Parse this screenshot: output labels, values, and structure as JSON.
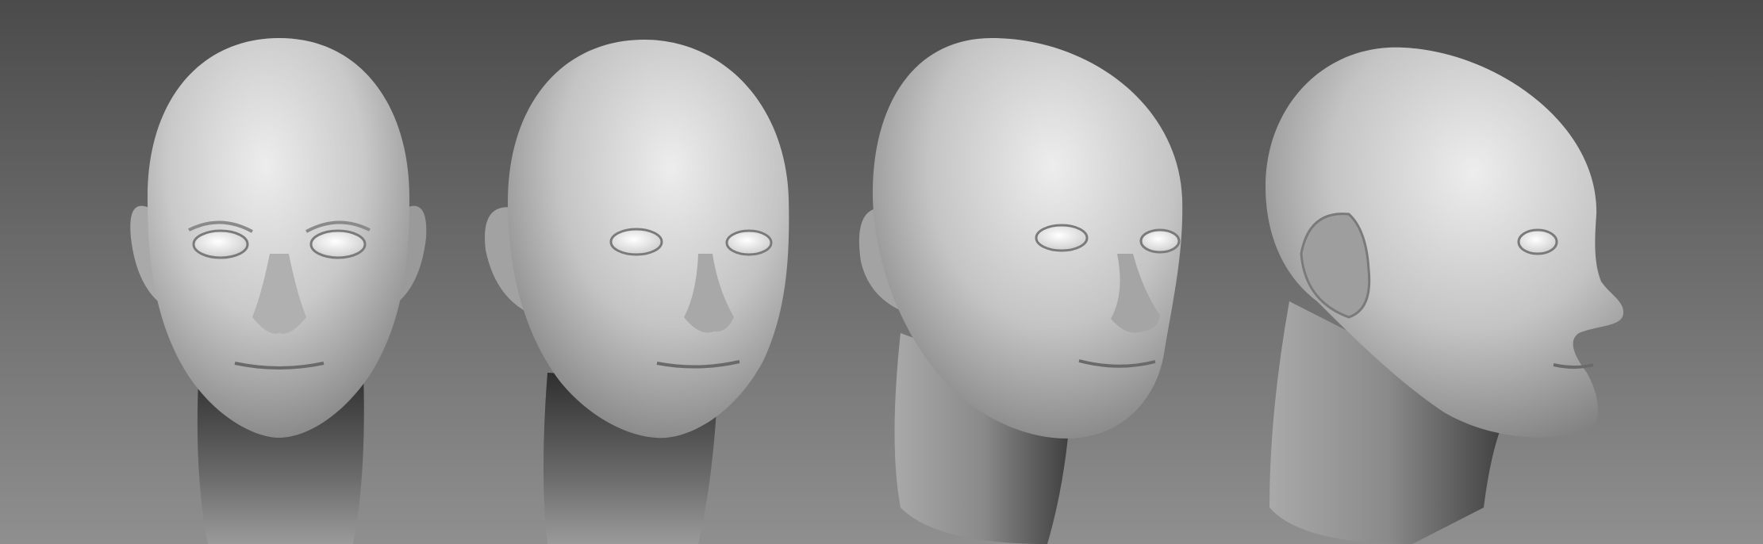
{
  "scene": {
    "subject": "sculpted-bald-head-turnaround",
    "views": [
      {
        "id": "front",
        "angle": "front"
      },
      {
        "id": "three-quarter-front",
        "angle": "three-quarter-front"
      },
      {
        "id": "three-quarter",
        "angle": "three-quarter"
      },
      {
        "id": "profile",
        "angle": "profile"
      }
    ],
    "colors": {
      "background_top": "#4b4b4b",
      "background_bottom": "#8f8f8f",
      "skin_light": "#e6e6e6",
      "skin_mid": "#b9b9b9",
      "skin_dark": "#6f6f6f",
      "eye_white": "#f2f2f2"
    }
  }
}
